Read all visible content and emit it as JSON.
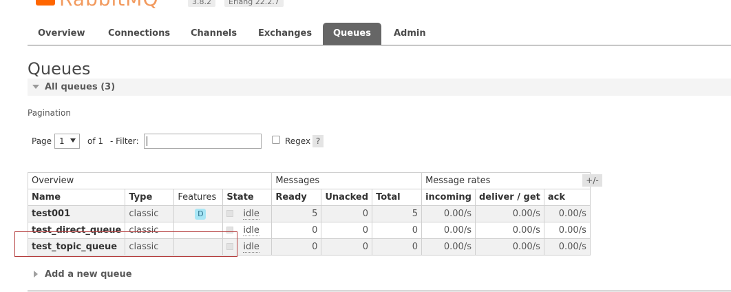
{
  "header": {
    "logo_text": "RabbitMQ",
    "version": "3.8.2",
    "erlang": "Erlang 22.2.7"
  },
  "nav": {
    "tabs": [
      {
        "label": "Overview"
      },
      {
        "label": "Connections"
      },
      {
        "label": "Channels"
      },
      {
        "label": "Exchanges"
      },
      {
        "label": "Queues"
      },
      {
        "label": "Admin"
      }
    ],
    "active": "Queues"
  },
  "page": {
    "title": "Queues",
    "section_label": "All queues (3)"
  },
  "pagination": {
    "label": "Pagination",
    "page_label": "Page",
    "page_value": "1",
    "of_label": "of 1",
    "filter_label": "- Filter:",
    "filter_value": "",
    "regex_label": "Regex",
    "help_label": "?"
  },
  "table": {
    "groups": [
      "Overview",
      "Messages",
      "Message rates"
    ],
    "columns": [
      "Name",
      "Type",
      "Features",
      "State",
      "Ready",
      "Unacked",
      "Total",
      "incoming",
      "deliver / get",
      "ack"
    ],
    "rows": [
      {
        "name": "test001",
        "type": "classic",
        "features": "D",
        "state": "idle",
        "ready": "5",
        "unacked": "0",
        "total": "5",
        "incoming": "0.00/s",
        "deliver_get": "0.00/s",
        "ack": "0.00/s"
      },
      {
        "name": "test_direct_queue",
        "type": "classic",
        "features": "",
        "state": "idle",
        "ready": "0",
        "unacked": "0",
        "total": "0",
        "incoming": "0.00/s",
        "deliver_get": "0.00/s",
        "ack": "0.00/s"
      },
      {
        "name": "test_topic_queue",
        "type": "classic",
        "features": "",
        "state": "idle",
        "ready": "0",
        "unacked": "0",
        "total": "0",
        "incoming": "0.00/s",
        "deliver_get": "0.00/s",
        "ack": "0.00/s"
      }
    ],
    "toggle_columns_label": "+/-"
  },
  "add_queue": {
    "label": "Add a new queue"
  },
  "colors": {
    "brand": "#ff6600",
    "active_tab": "#666666",
    "durable_badge": "#a8e6f5",
    "annotation_box": "#b43c3c"
  }
}
